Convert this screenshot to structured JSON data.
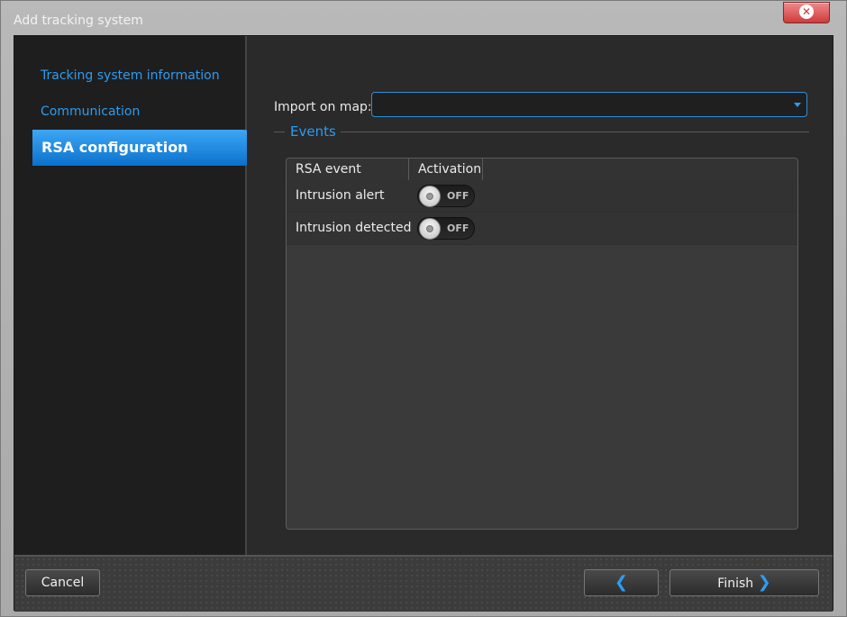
{
  "window": {
    "title": "Add tracking system"
  },
  "sidebar": {
    "items": [
      {
        "label": "Tracking system information"
      },
      {
        "label": "Communication"
      },
      {
        "label": "RSA configuration"
      }
    ]
  },
  "form": {
    "import_label": "Import on map:",
    "import_value": ""
  },
  "events": {
    "title": "Events",
    "columns": [
      "RSA event",
      "Activation"
    ],
    "rows": [
      {
        "name": "Intrusion alert",
        "activation": "OFF"
      },
      {
        "name": "Intrusion detected",
        "activation": "OFF"
      }
    ]
  },
  "footer": {
    "cancel_label": "Cancel",
    "finish_label": "Finish"
  },
  "icons": {
    "close": "close-icon",
    "back": "chevron-left-icon",
    "next": "chevron-right-icon",
    "dropdown": "chevron-down-icon"
  },
  "colors": {
    "accent": "#2d9cf0",
    "active_tab": "#1a88e0",
    "close_button": "#d94848"
  }
}
